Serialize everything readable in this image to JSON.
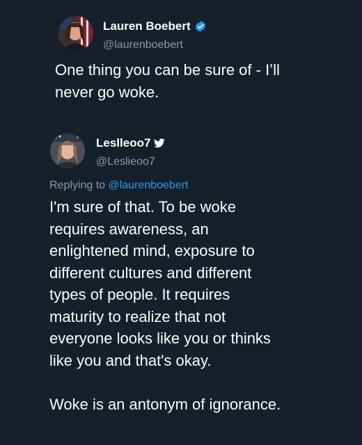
{
  "original_tweet": {
    "display_name": "Lauren Boebert",
    "handle": "@laurenboebert",
    "text": "One thing you can be sure of - I’ll\nnever go woke.",
    "verified_icon": "verified-badge-icon"
  },
  "reply_tweet": {
    "display_name": "Leslleoo7",
    "handle": "@Leslieoo7",
    "replying_prefix": "Replying to",
    "replying_handle": "@laurenboebert",
    "text": "I'm sure of that. To be woke\nrequires awareness, an\nenlightened mind, exposure to\ndifferent cultures and different\ntypes of people. It requires\nmaturity to realize that not\neveryone looks like you or thinks\nlike you and that's okay.\n\nWoke is an antonym of ignorance.",
    "name_icon": "bird-icon"
  },
  "colors": {
    "background": "#15202b",
    "text": "#ffffff",
    "secondary_text": "#8b98a5",
    "link": "#1d9bf0"
  }
}
